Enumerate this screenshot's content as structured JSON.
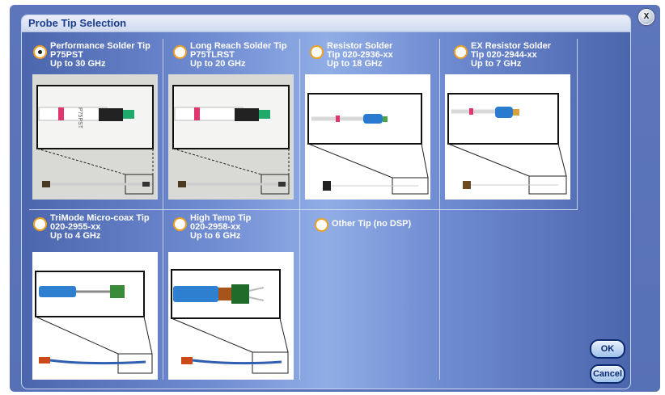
{
  "dialog": {
    "title": "Probe Tip Selection",
    "close_label": "X"
  },
  "options": [
    {
      "line1": "Performance Solder Tip",
      "line2": "P75PST",
      "line3": "Up to 30 GHz",
      "selected": true
    },
    {
      "line1": "Long Reach Solder Tip",
      "line2": "P75TLRST",
      "line3": "Up to 20 GHz",
      "selected": false
    },
    {
      "line1": "Resistor Solder",
      "line2": "Tip 020-2936-xx",
      "line3": "Up to 18 GHz",
      "selected": false
    },
    {
      "line1": "EX Resistor Solder",
      "line2": "Tip 020-2944-xx",
      "line3": "Up to 7 GHz",
      "selected": false
    },
    {
      "line1": "TriMode Micro-coax Tip",
      "line2": "020-2955-xx",
      "line3": "Up to 4 GHz",
      "selected": false
    },
    {
      "line1": "High Temp Tip",
      "line2": "020-2958-xx",
      "line3": "Up to 6 GHz",
      "selected": false
    },
    {
      "line1": "Other Tip (no DSP)",
      "selected": false
    }
  ],
  "photo_label": "P75PST",
  "buttons": {
    "ok": "OK",
    "cancel": "Cancel"
  },
  "colors": {
    "frame": "#5d76bb",
    "title_text": "#1b3d8f",
    "radio_ring": "#f0a01f",
    "button_border": "#0b2a6f"
  }
}
